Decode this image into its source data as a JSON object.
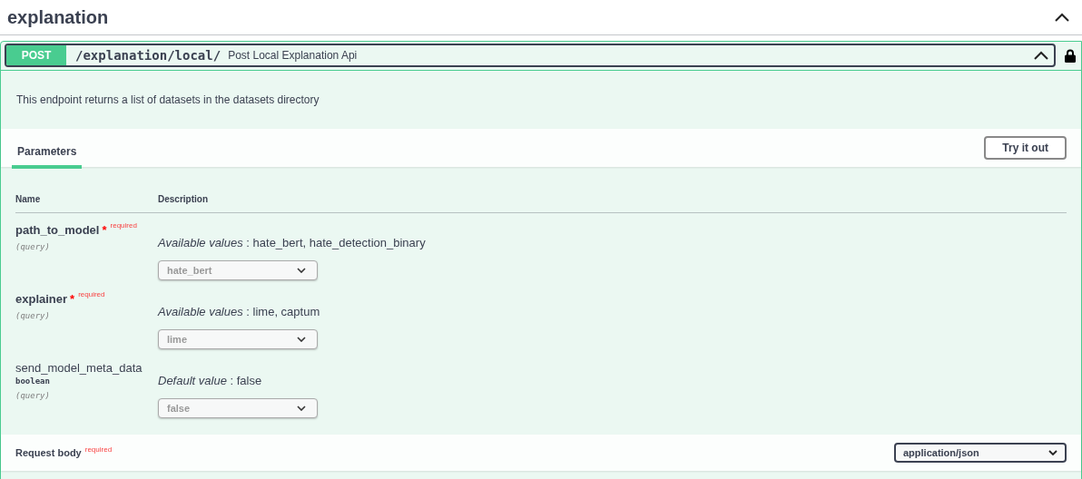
{
  "section": {
    "title": "explanation",
    "expanded": true
  },
  "operation": {
    "method": "POST",
    "path": "/explanation/local/",
    "summary": "Post Local Explanation Api",
    "expanded": true,
    "locked": true,
    "description": "This endpoint returns a list of datasets in the datasets directory",
    "tab": {
      "label": "Parameters",
      "selected": true
    },
    "try_button": "Try it out",
    "columns": [
      "Name",
      "Description"
    ],
    "parameters": [
      {
        "name": "path_to_model",
        "required": true,
        "required_mark": "*",
        "required_label": "required",
        "in": "(query)",
        "desc_label": "Available values",
        "desc_value": " : hate_bert, hate_detection_binary",
        "select": "hate_bert"
      },
      {
        "name": "explainer",
        "required": true,
        "required_mark": "*",
        "required_label": "required",
        "in": "(query)",
        "desc_label": "Available values",
        "desc_value": " : lime, captum",
        "select": "lime"
      },
      {
        "name": "send_model_meta_data",
        "required": false,
        "type": "boolean",
        "in": "(query)",
        "desc_label": "Default value",
        "desc_value": " : false",
        "select": "false"
      }
    ],
    "request_body": {
      "label": "Request body",
      "required": true,
      "required_label": "required",
      "content_type": "application/json"
    }
  }
}
